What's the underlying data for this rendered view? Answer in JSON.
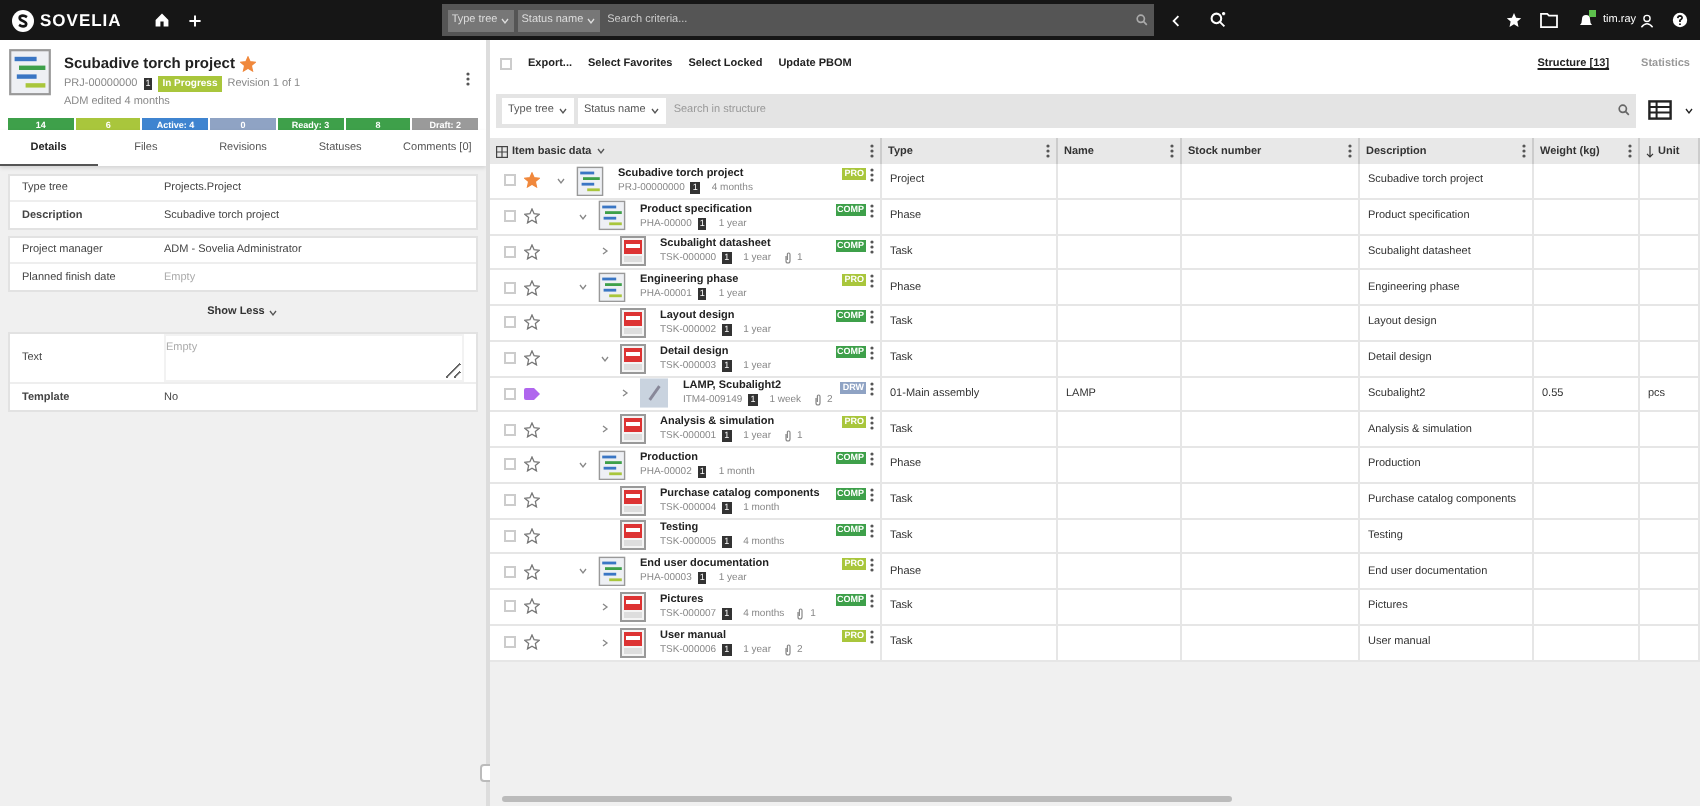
{
  "top_bar": {
    "logo": "SOVELIA",
    "filters": [
      "Type tree",
      "Status name"
    ],
    "search": {
      "placeholder": "Search criteria..."
    },
    "user": "tim.ray"
  },
  "item": {
    "title": "Scubadive torch project",
    "favorite": true,
    "code": "PRJ-00000000",
    "revision_badge": "1",
    "status": "In Progress",
    "revision": "Revision 1 of 1",
    "edited": "ADM edited 4 months",
    "status_bar": [
      {
        "label": "14",
        "color": "#3ea04a"
      },
      {
        "label": "6",
        "color": "#a9c63c"
      },
      {
        "label": "Active: 4",
        "color": "#3f84d0"
      },
      {
        "label": "0",
        "color": "#8fa3c4"
      },
      {
        "label": "Ready: 3",
        "color": "#3ea04a"
      },
      {
        "label": "8",
        "color": "#3ea04a"
      },
      {
        "label": "Draft: 2",
        "color": "#9a9a9a"
      }
    ]
  },
  "tabs": [
    {
      "label": "Details",
      "selected": true
    },
    {
      "label": "Files",
      "selected": false
    },
    {
      "label": "Revisions",
      "selected": false
    },
    {
      "label": "Statuses",
      "selected": false
    },
    {
      "label": "Comments [0]",
      "selected": false
    }
  ],
  "field_groups": [
    [
      {
        "label": "Type tree",
        "value": "Projects.Project",
        "strong": false,
        "kind": "text"
      },
      {
        "label": "Description",
        "value": "Scubadive torch project",
        "strong": true,
        "kind": "text"
      }
    ],
    [
      {
        "label": "Project manager",
        "value": "ADM - Sovelia Administrator",
        "strong": false,
        "kind": "text"
      },
      {
        "label": "Planned finish date",
        "placeholder": "Empty",
        "strong": false,
        "kind": "text"
      }
    ]
  ],
  "show_less": "Show Less",
  "extra_fields": [
    {
      "label": "Text",
      "placeholder": "Empty",
      "strong": false,
      "kind": "textarea"
    },
    {
      "label": "Template",
      "value": "No",
      "strong": true,
      "kind": "text"
    }
  ],
  "toolbar": {
    "checked": false,
    "actions": [
      "Export...",
      "Select Favorites",
      "Select Locked",
      "Update PBOM"
    ],
    "views": [
      {
        "label": "Structure [13]",
        "selected": true
      },
      {
        "label": "Statistics",
        "selected": false
      }
    ]
  },
  "filter_bar": {
    "filters": [
      "Type tree",
      "Status name"
    ],
    "search": {
      "placeholder": "Search in structure"
    }
  },
  "columns": [
    "Item basic data",
    "Type",
    "Name",
    "Stock number",
    "Description",
    "Weight (kg)",
    "Unit"
  ],
  "rows": [
    {
      "title": "Scubadive torch project",
      "code": "PRJ-00000000",
      "rev": "1",
      "age": "4 months",
      "status": {
        "label": "PRO",
        "kind": "pro"
      },
      "checked": false,
      "favorite": true,
      "tagged": false,
      "kind": "project",
      "expanded": true,
      "type": "Project",
      "description": "Scubadive torch project",
      "children": [
        {
          "title": "Product specification",
          "code": "PHA-00000",
          "rev": "1",
          "age": "1 year",
          "status": {
            "label": "COMP",
            "kind": "comp"
          },
          "checked": false,
          "favorite": false,
          "tagged": false,
          "kind": "project",
          "expanded": true,
          "type": "Phase",
          "description": "Product specification",
          "children": [
            {
              "title": "Scubalight datasheet",
              "code": "TSK-000000",
              "rev": "1",
              "age": "1 year",
              "attachments": "1",
              "status": {
                "label": "COMP",
                "kind": "comp"
              },
              "checked": false,
              "favorite": false,
              "tagged": false,
              "kind": "task",
              "expanded": false,
              "type": "Task",
              "description": "Scubalight datasheet"
            }
          ]
        },
        {
          "title": "Engineering phase",
          "code": "PHA-00001",
          "rev": "1",
          "age": "1 year",
          "status": {
            "label": "PRO",
            "kind": "pro"
          },
          "checked": false,
          "favorite": false,
          "tagged": false,
          "kind": "project",
          "expanded": true,
          "type": "Phase",
          "description": "Engineering phase",
          "children": [
            {
              "title": "Layout design",
              "code": "TSK-000002",
              "rev": "1",
              "age": "1 year",
              "status": {
                "label": "COMP",
                "kind": "comp"
              },
              "checked": false,
              "favorite": false,
              "tagged": false,
              "kind": "task",
              "type": "Task",
              "description": "Layout design"
            },
            {
              "title": "Detail design",
              "code": "TSK-000003",
              "rev": "1",
              "age": "1 year",
              "status": {
                "label": "COMP",
                "kind": "comp"
              },
              "checked": false,
              "favorite": false,
              "tagged": false,
              "kind": "task",
              "expanded": true,
              "type": "Task",
              "description": "Detail design",
              "children": [
                {
                  "title": "LAMP, Scubalight2",
                  "code": "ITM4-009149",
                  "rev": "1",
                  "age": "1 week",
                  "attachments": "2",
                  "status": {
                    "label": "DRW",
                    "kind": "drw"
                  },
                  "checked": false,
                  "favorite": false,
                  "tagged": true,
                  "kind": "item",
                  "expanded": false,
                  "type": "01-Main assembly",
                  "name": "LAMP",
                  "description": "Scubalight2",
                  "weight": "0.55",
                  "unit": "pcs"
                }
              ]
            },
            {
              "title": "Analysis & simulation",
              "code": "TSK-000001",
              "rev": "1",
              "age": "1 year",
              "attachments": "1",
              "status": {
                "label": "PRO",
                "kind": "pro"
              },
              "checked": false,
              "favorite": false,
              "tagged": false,
              "kind": "task",
              "expanded": false,
              "type": "Task",
              "description": "Analysis & simulation"
            }
          ]
        },
        {
          "title": "Production",
          "code": "PHA-00002",
          "rev": "1",
          "age": "1 month",
          "status": {
            "label": "COMP",
            "kind": "comp"
          },
          "checked": false,
          "favorite": false,
          "tagged": false,
          "kind": "project",
          "expanded": true,
          "type": "Phase",
          "description": "Production",
          "children": [
            {
              "title": "Purchase catalog components",
              "code": "TSK-000004",
              "rev": "1",
              "age": "1 month",
              "status": {
                "label": "COMP",
                "kind": "comp"
              },
              "checked": false,
              "favorite": false,
              "tagged": false,
              "kind": "task",
              "type": "Task",
              "description": "Purchase catalog components"
            },
            {
              "title": "Testing",
              "code": "TSK-000005",
              "rev": "1",
              "age": "4 months",
              "status": {
                "label": "COMP",
                "kind": "comp"
              },
              "checked": false,
              "favorite": false,
              "tagged": false,
              "kind": "task",
              "type": "Task",
              "description": "Testing"
            }
          ]
        },
        {
          "title": "End user documentation",
          "code": "PHA-00003",
          "rev": "1",
          "age": "1 year",
          "status": {
            "label": "PRO",
            "kind": "pro"
          },
          "checked": false,
          "favorite": false,
          "tagged": false,
          "kind": "project",
          "expanded": true,
          "type": "Phase",
          "description": "End user documentation",
          "children": [
            {
              "title": "Pictures",
              "code": "TSK-000007",
              "rev": "1",
              "age": "4 months",
              "attachments": "1",
              "status": {
                "label": "COMP",
                "kind": "comp"
              },
              "checked": false,
              "favorite": false,
              "tagged": false,
              "kind": "task",
              "expanded": false,
              "type": "Task",
              "description": "Pictures"
            },
            {
              "title": "User manual",
              "code": "TSK-000006",
              "rev": "1",
              "age": "1 year",
              "attachments": "2",
              "status": {
                "label": "PRO",
                "kind": "pro"
              },
              "checked": false,
              "favorite": false,
              "tagged": false,
              "kind": "task",
              "expanded": false,
              "type": "Task",
              "description": "User manual"
            }
          ]
        }
      ]
    }
  ]
}
